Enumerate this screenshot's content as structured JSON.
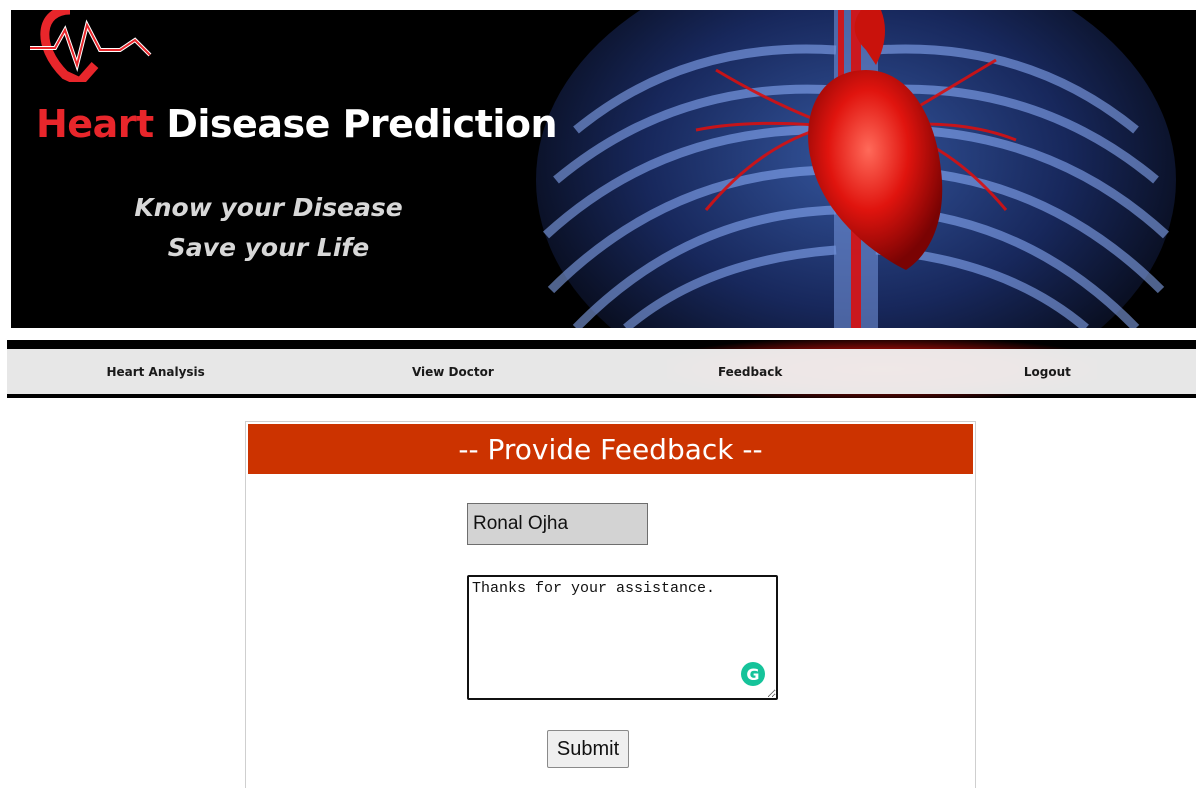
{
  "banner": {
    "title_accent": "Heart",
    "title_rest": "Disease Prediction",
    "tagline_1": "Know your Disease",
    "tagline_2": "Save your Life",
    "colors": {
      "accent": "#e8262b",
      "background": "#000000"
    }
  },
  "nav": {
    "items": [
      {
        "label": "Heart Analysis"
      },
      {
        "label": "View Doctor"
      },
      {
        "label": "Feedback"
      },
      {
        "label": "Logout"
      }
    ]
  },
  "feedback_form": {
    "heading": "-- Provide Feedback --",
    "name_value": "Ronal Ojha",
    "message_value": "Thanks for your assistance.",
    "submit_label": "Submit",
    "grammarly_icon": "G",
    "colors": {
      "header": "#cc3300"
    }
  }
}
